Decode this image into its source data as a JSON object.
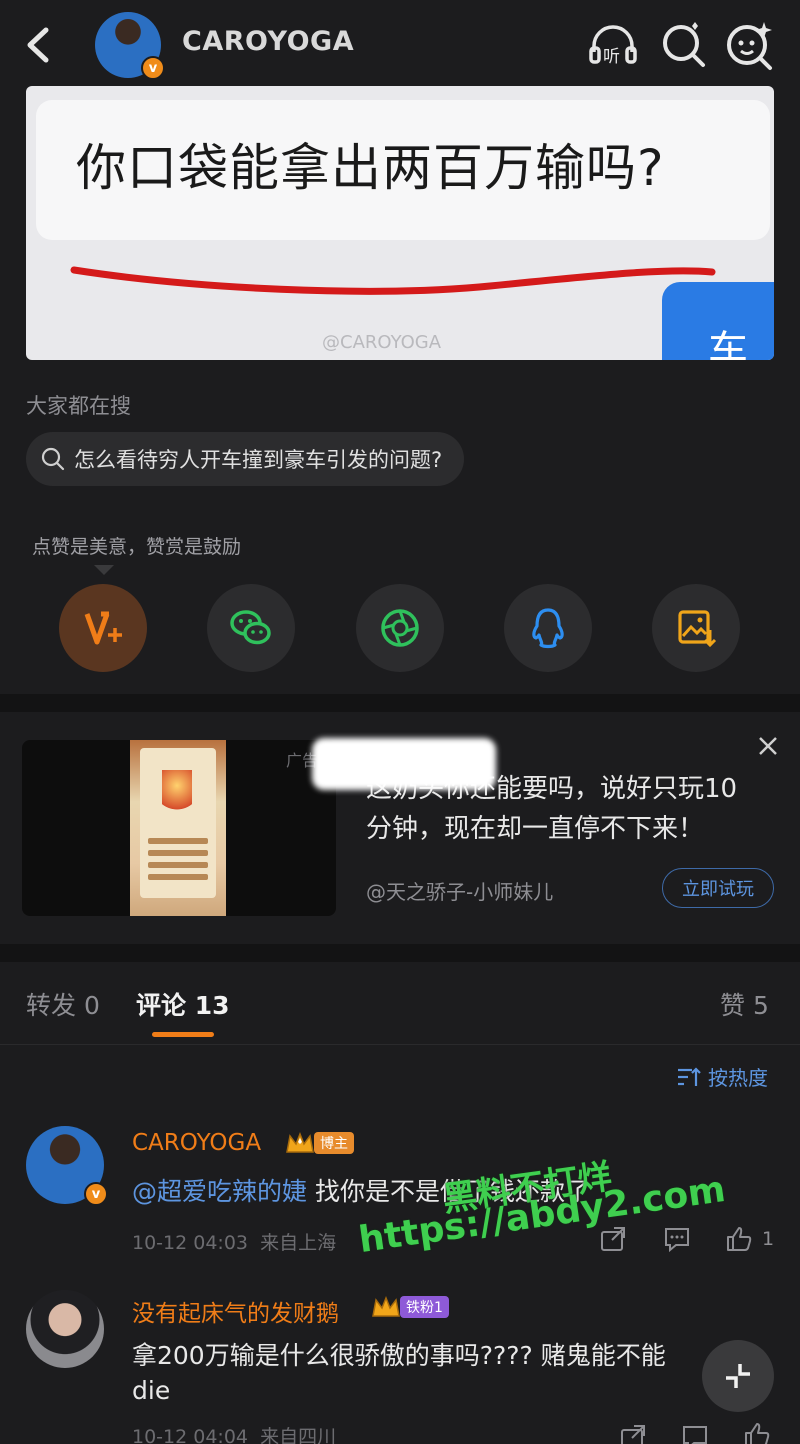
{
  "header": {
    "username": "CAROYOGA",
    "verified_badge": "v",
    "icons": [
      "back-icon",
      "listen-icon",
      "search-icon",
      "more-icon"
    ],
    "listen_label": "听"
  },
  "post_image": {
    "headline": "你口袋能拿出两百万输吗?",
    "bubble_fragment": "车",
    "watermark": "@CAROYOGA"
  },
  "search": {
    "section_label": "大家都在搜",
    "query": "怎么看待穷人开车撞到豪车引发的问题?"
  },
  "share": {
    "caption": "点赞是美意，赞赏是鼓励",
    "buttons": [
      "reward",
      "wechat",
      "moments",
      "qq",
      "save-image"
    ]
  },
  "ad": {
    "tag": "广告",
    "line1": "这奶头你还能要吗，说好只玩10",
    "line2": "分钟，现在却一直停不下来！",
    "source": "@天之骄子-小师妹儿",
    "cta": "立即试玩"
  },
  "tabs": {
    "repost": "转发 0",
    "comments": "评论 13",
    "likes": "赞 5",
    "sort": "按热度"
  },
  "comments": [
    {
      "name": "CAROYOGA",
      "badge": "博主",
      "mention": "@超爱吃辣的婕",
      "text": " 找你是不是借了钱还款了",
      "time": "10-12 04:03",
      "location": "来自上海",
      "likes": "1"
    },
    {
      "name": "没有起床气的发财鹅",
      "badge": "铁粉1",
      "text_line1": "拿200万输是什么很骄傲的事吗????  赌鬼能不能",
      "text_line2": "die",
      "time": "10-12 04:04",
      "location": "来自四川"
    }
  ],
  "overlay_watermark": {
    "line1": "黑料不打烊",
    "line2": "https://abdy2.com"
  },
  "colors": {
    "background": "#1c1c1e",
    "accent_orange": "#f07d18",
    "link_blue": "#5d95e0",
    "wechat_green": "#2fc15c",
    "qq_blue": "#2d8ef0"
  }
}
